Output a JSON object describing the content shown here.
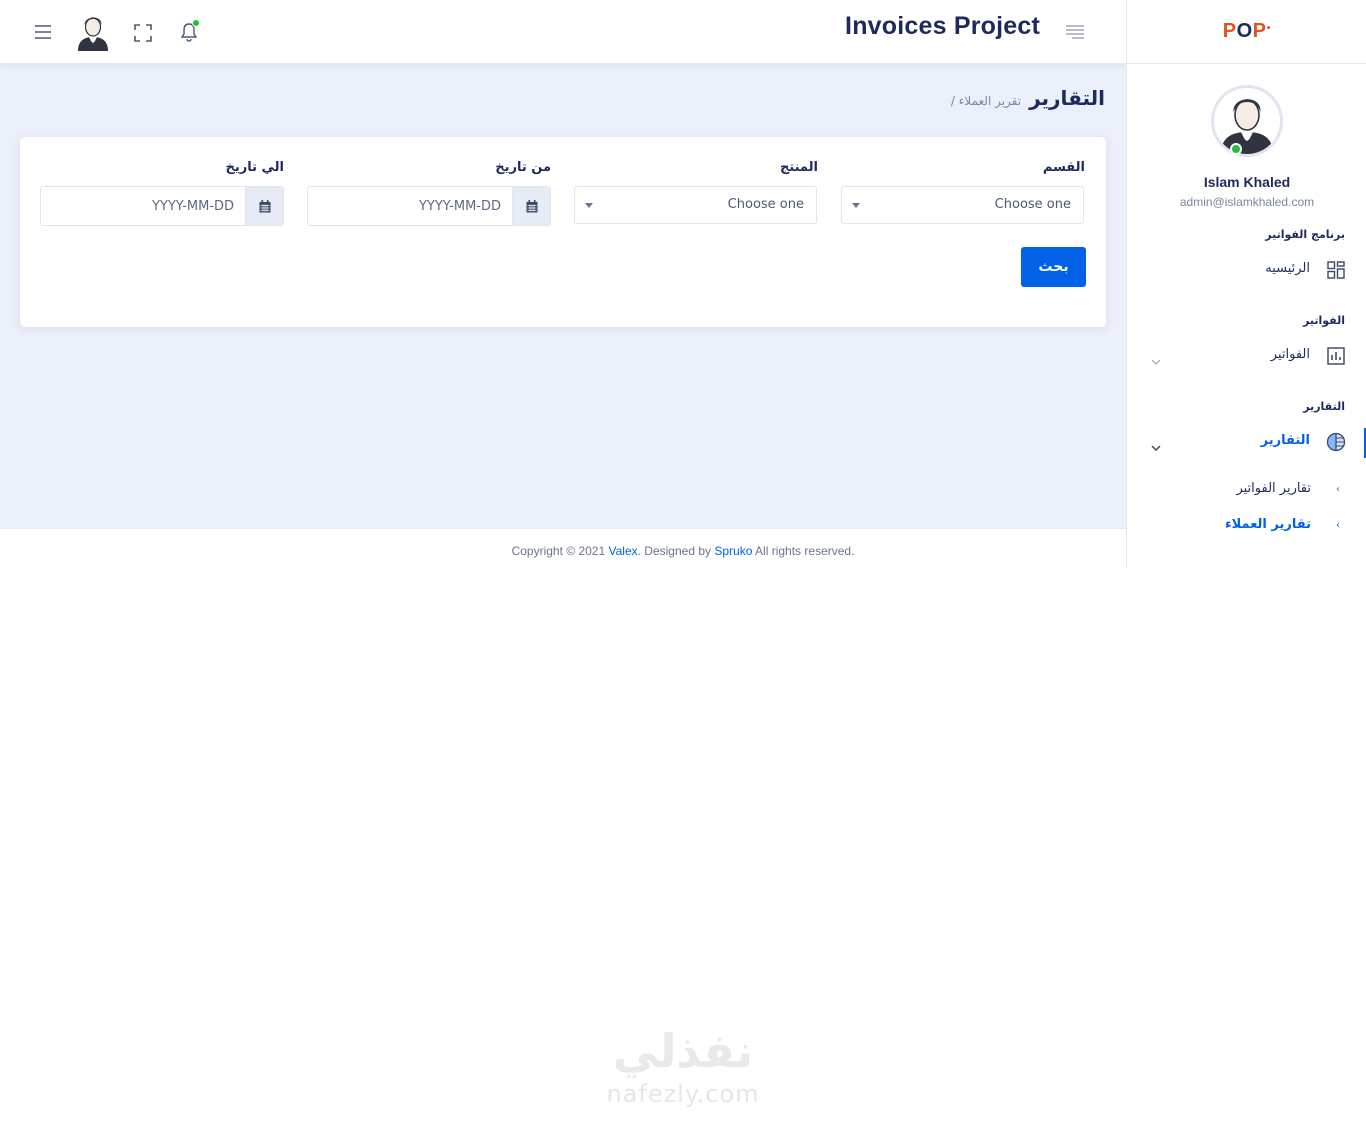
{
  "header": {
    "app_title": "Invoices Project"
  },
  "page": {
    "title": "التقارير",
    "breadcrumb": "/ تقرير العملاء"
  },
  "form": {
    "section_label": "القسم",
    "section_value": "Choose one",
    "product_label": "المنتج",
    "product_value": "Choose one",
    "from_date_label": "من تاريخ",
    "from_date_placeholder": "YYYY-MM-DD",
    "to_date_label": "الي تاريخ",
    "to_date_placeholder": "YYYY-MM-DD",
    "search_button": "بحث"
  },
  "sidebar": {
    "logo_prefix": "P",
    "logo_middle": "O",
    "logo_suffix": "P",
    "user_name": "Islam Khaled",
    "user_email": "admin@islamkhaled.com",
    "cat_program": "برنامج الفواتير",
    "item_home": "الرئيسيه",
    "cat_invoices": "الفواتير",
    "item_invoices": "الفواتير",
    "cat_reports": "التقارير",
    "item_reports": "التقارير",
    "sub_invoice_reports": "تقارير الفواتير",
    "sub_customer_reports": "تقارير العملاء"
  },
  "footer": {
    "prefix": "Copyright © 2021 ",
    "brand": "Valex",
    "middle": ". Designed by ",
    "designer": "Spruko",
    "suffix": " All rights reserved."
  },
  "watermark": {
    "arabic": "نفذلي",
    "latin": "nafezly.com"
  },
  "colors": {
    "primary": "#0162e8",
    "online": "#22c03c",
    "heading": "#1d2a5c",
    "background": "#ecf0fa"
  }
}
